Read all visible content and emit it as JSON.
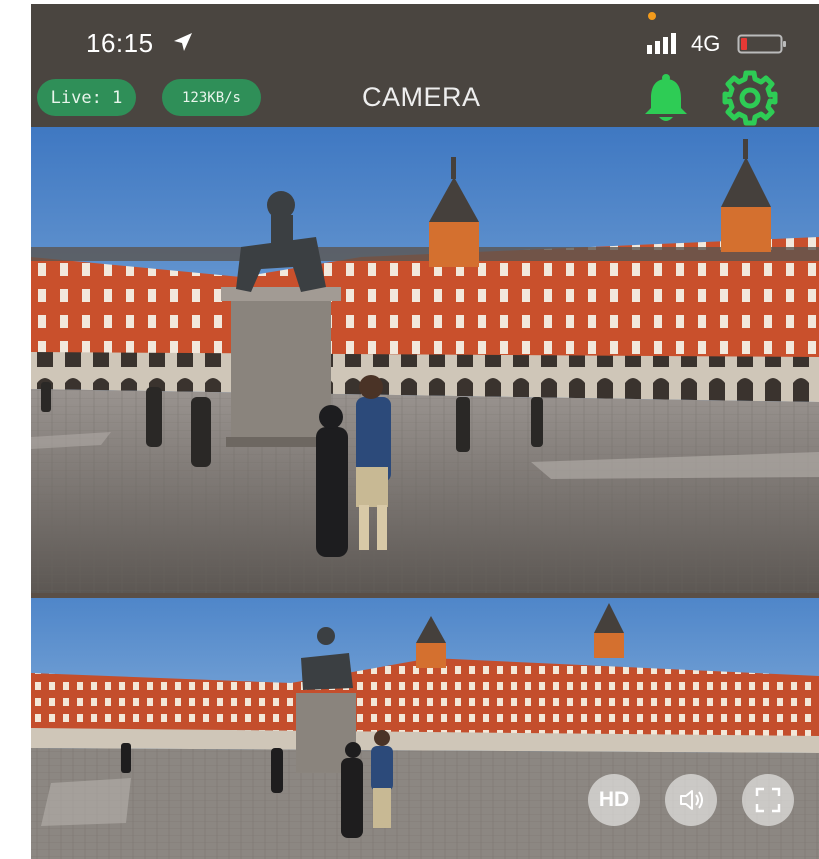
{
  "status_bar": {
    "time": "16:15",
    "network": "4G",
    "location_icon": "location-arrow-icon",
    "signal_icon": "signal-bars-icon",
    "battery_icon": "battery-low-icon",
    "battery_color": "#e53935",
    "dot_color": "#f39b1c"
  },
  "header": {
    "live_badge": "Live: 1",
    "rate_badge": "123KB/s",
    "title": "CAMERA",
    "bell_icon": "bell-icon",
    "settings_icon": "gear-icon",
    "accent_color": "#2ecc55"
  },
  "video_controls": {
    "hd_label": "HD",
    "sound_icon": "speaker-icon",
    "fullscreen_icon": "fullscreen-icon"
  }
}
